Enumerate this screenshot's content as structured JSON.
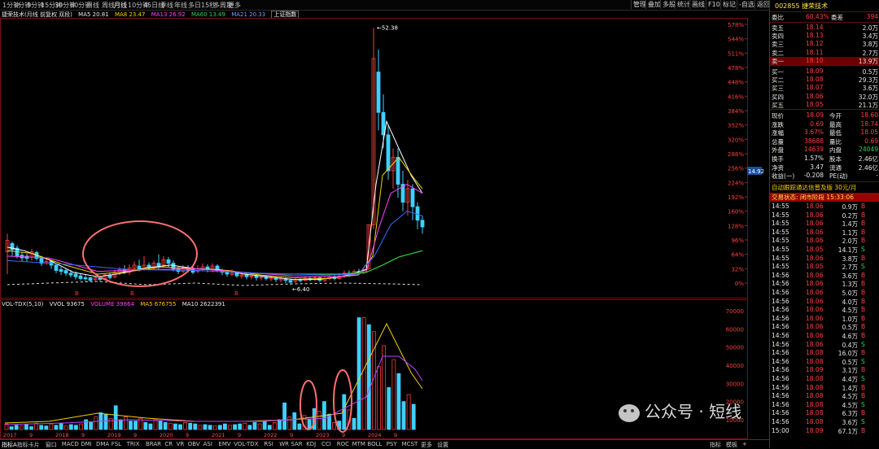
{
  "toolbar": {
    "periods": [
      "1分钟",
      "1分钟",
      "5分钟",
      "15分钟",
      "30分钟",
      "60分钟",
      "日线",
      "周线",
      "月线",
      "10分钟",
      "45日线",
      "季线",
      "年线",
      "多日",
      "15秒",
      "多周期",
      "更多"
    ],
    "active_period": "月线",
    "right_buttons": [
      "管理",
      "叠加",
      "多股",
      "统计",
      "画线",
      "F10",
      "标记",
      "-自选",
      "返回"
    ]
  },
  "legend": {
    "stock_line": "捷荣技术(月线 前复权 双段)",
    "ma5": "MA5 20.81",
    "ma8": "MA8 23.47",
    "ma13": "MA13 26.92",
    "ma60": "MA60 13.49",
    "ma21": "MA21 20.33",
    "sz": "上证指数"
  },
  "price_axis": {
    "labels": [
      "578%",
      "544%",
      "511%",
      "478%",
      "448%",
      "416%",
      "384%",
      "352%",
      "320%",
      "288%",
      "256%",
      "224%",
      "192%",
      "160%",
      "128%",
      "96%",
      "64%",
      "32%",
      "0%"
    ],
    "peak_label": "52.38",
    "low_label": "6.40",
    "cur_tag": "14.92"
  },
  "volume_legend": {
    "ind": "VOL-TDX(5,10)",
    "vvol": "VVOL 93675",
    "vol": "VOLUME 39864",
    "ma5": "MA5 676755",
    "ma10": "MA10 2622391"
  },
  "volume_axis": {
    "labels": [
      "70000",
      "60000",
      "50000",
      "40000",
      "30000",
      "20000",
      "10000"
    ]
  },
  "timeline": {
    "labels": [
      "2017",
      "9",
      "2018",
      "9",
      "2019",
      "9",
      "2020",
      "9",
      "2021",
      "9",
      "2022",
      "9",
      "2023",
      "9",
      "2024",
      "9"
    ]
  },
  "bottom_tabs": [
    "指标A",
    "指标卡片",
    "窗口",
    "MACD",
    "DMI",
    "DMA",
    "FSL",
    "TRIX",
    "BRAR",
    "CR",
    "VR",
    "OBV",
    "ASI",
    "EMV",
    "VOL-TDX",
    "RSI",
    "WR",
    "SAR",
    "KDJ",
    "CCI",
    "ROC",
    "MTM",
    "BOLL",
    "PSY",
    "MCST",
    "更多",
    "设置"
  ],
  "bottom_right": [
    "指标",
    "模板",
    "+"
  ],
  "quote": {
    "code_name": "002855 捷荣技术",
    "ratio_label": "委比",
    "ratio_value": "60.43%",
    "diff_label": "委差",
    "diff_value": "394",
    "asks": [
      {
        "label": "卖五",
        "price": "18.14",
        "vol": "2.0万"
      },
      {
        "label": "卖四",
        "price": "18.13",
        "vol": "3.4万"
      },
      {
        "label": "卖三",
        "price": "18.12",
        "vol": "3.8万"
      },
      {
        "label": "卖二",
        "price": "18.11",
        "vol": "2.7万"
      },
      {
        "label": "卖一",
        "price": "18.10",
        "vol": "13.9万"
      }
    ],
    "bids": [
      {
        "label": "买一",
        "price": "18.09",
        "vol": "0.5万"
      },
      {
        "label": "买二",
        "price": "18.08",
        "vol": "29.3万"
      },
      {
        "label": "买三",
        "price": "18.07",
        "vol": "3.6万"
      },
      {
        "label": "买四",
        "price": "18.06",
        "vol": "32.0万"
      },
      {
        "label": "买五",
        "price": "18.05",
        "vol": "21.1万"
      }
    ],
    "stats": [
      {
        "l1": "现价",
        "v1": "18.09",
        "l2": "今开",
        "v2": "18.60"
      },
      {
        "l1": "涨跌",
        "v1": "0.69",
        "l2": "最高",
        "v2": "18.74"
      },
      {
        "l1": "涨幅",
        "v1": "3.67%",
        "l2": "最低",
        "v2": "18.05"
      },
      {
        "l1": "总量",
        "v1": "38688",
        "l2": "量比",
        "v2": "0.69"
      },
      {
        "l1": "外盘",
        "v1": "14639",
        "l2": "内盘",
        "v2": "24049"
      },
      {
        "l1": "换手",
        "v1": "1.57%",
        "l2": "股本",
        "v2": "2.46亿"
      },
      {
        "l1": "净资",
        "v1": "3.47",
        "l2": "流通",
        "v2": "2.46亿"
      },
      {
        "l1": "收益(一)",
        "v1": "-0.208",
        "l2": "PE(动)",
        "v2": "-"
      }
    ],
    "promo": "自动跟踪通达信普及版  30元/月",
    "trade_status": "交易状态: 闭市阶段  15:33:06"
  },
  "ticks": [
    {
      "t": "14:55",
      "p": "18.06",
      "v": "0.9万",
      "d": "B"
    },
    {
      "t": "14:55",
      "p": "18.06",
      "v": "0.2万",
      "d": "B"
    },
    {
      "t": "14:55",
      "p": "18.06",
      "v": "1.4万",
      "d": "B"
    },
    {
      "t": "14:55",
      "p": "18.06",
      "v": "1.1万",
      "d": "B"
    },
    {
      "t": "14:55",
      "p": "18.06",
      "v": "2.0万",
      "d": "B"
    },
    {
      "t": "14:55",
      "p": "18.05",
      "v": "14.1万",
      "d": "S"
    },
    {
      "t": "14:55",
      "p": "18.06",
      "v": "3.8万",
      "d": "B"
    },
    {
      "t": "14:55",
      "p": "18.05",
      "v": "2.7万",
      "d": "S"
    },
    {
      "t": "14:56",
      "p": "18.06",
      "v": "3.6万",
      "d": "B"
    },
    {
      "t": "14:56",
      "p": "18.06",
      "v": "1.3万",
      "d": "B"
    },
    {
      "t": "14:56",
      "p": "18.06",
      "v": "5.0万",
      "d": "B"
    },
    {
      "t": "14:56",
      "p": "18.06",
      "v": "4.0万",
      "d": "B"
    },
    {
      "t": "14:56",
      "p": "18.06",
      "v": "4.5万",
      "d": "B"
    },
    {
      "t": "14:56",
      "p": "18.06",
      "v": "1.0万",
      "d": "B"
    },
    {
      "t": "14:56",
      "p": "18.06",
      "v": "0.5万",
      "d": "B"
    },
    {
      "t": "14:56",
      "p": "18.06",
      "v": "4.6万",
      "d": "B"
    },
    {
      "t": "14:56",
      "p": "18.06",
      "v": "0.4万",
      "d": "S"
    },
    {
      "t": "14:56",
      "p": "18.08",
      "v": "16.0万",
      "d": "B"
    },
    {
      "t": "14:56",
      "p": "18.08",
      "v": "0.5万",
      "d": "S"
    },
    {
      "t": "14:56",
      "p": "18.09",
      "v": "3.1万",
      "d": "B"
    },
    {
      "t": "14:56",
      "p": "18.08",
      "v": "4.4万",
      "d": "S"
    },
    {
      "t": "14:56",
      "p": "18.08",
      "v": "1.4万",
      "d": "B"
    },
    {
      "t": "14:56",
      "p": "18.08",
      "v": "4.5万",
      "d": "B"
    },
    {
      "t": "14:56",
      "p": "18.08",
      "v": "4.5万",
      "d": "S"
    },
    {
      "t": "14:56",
      "p": "18.08",
      "v": "6.3万",
      "d": "B"
    },
    {
      "t": "14:56",
      "p": "18.08",
      "v": "3.6万",
      "d": "S"
    },
    {
      "t": "15:00",
      "p": "18.09",
      "v": "67.1万",
      "d": "B"
    }
  ],
  "watermark": "公众号 · 短线",
  "colors": {
    "up": "#ff3b3b",
    "down": "#3fd0ff",
    "ma5": "#ffffff",
    "ma8": "#f0d000",
    "ma13": "#ff40ff",
    "ma60": "#30d030",
    "ma21": "#3a6cff",
    "accent": "#9a0000"
  }
}
